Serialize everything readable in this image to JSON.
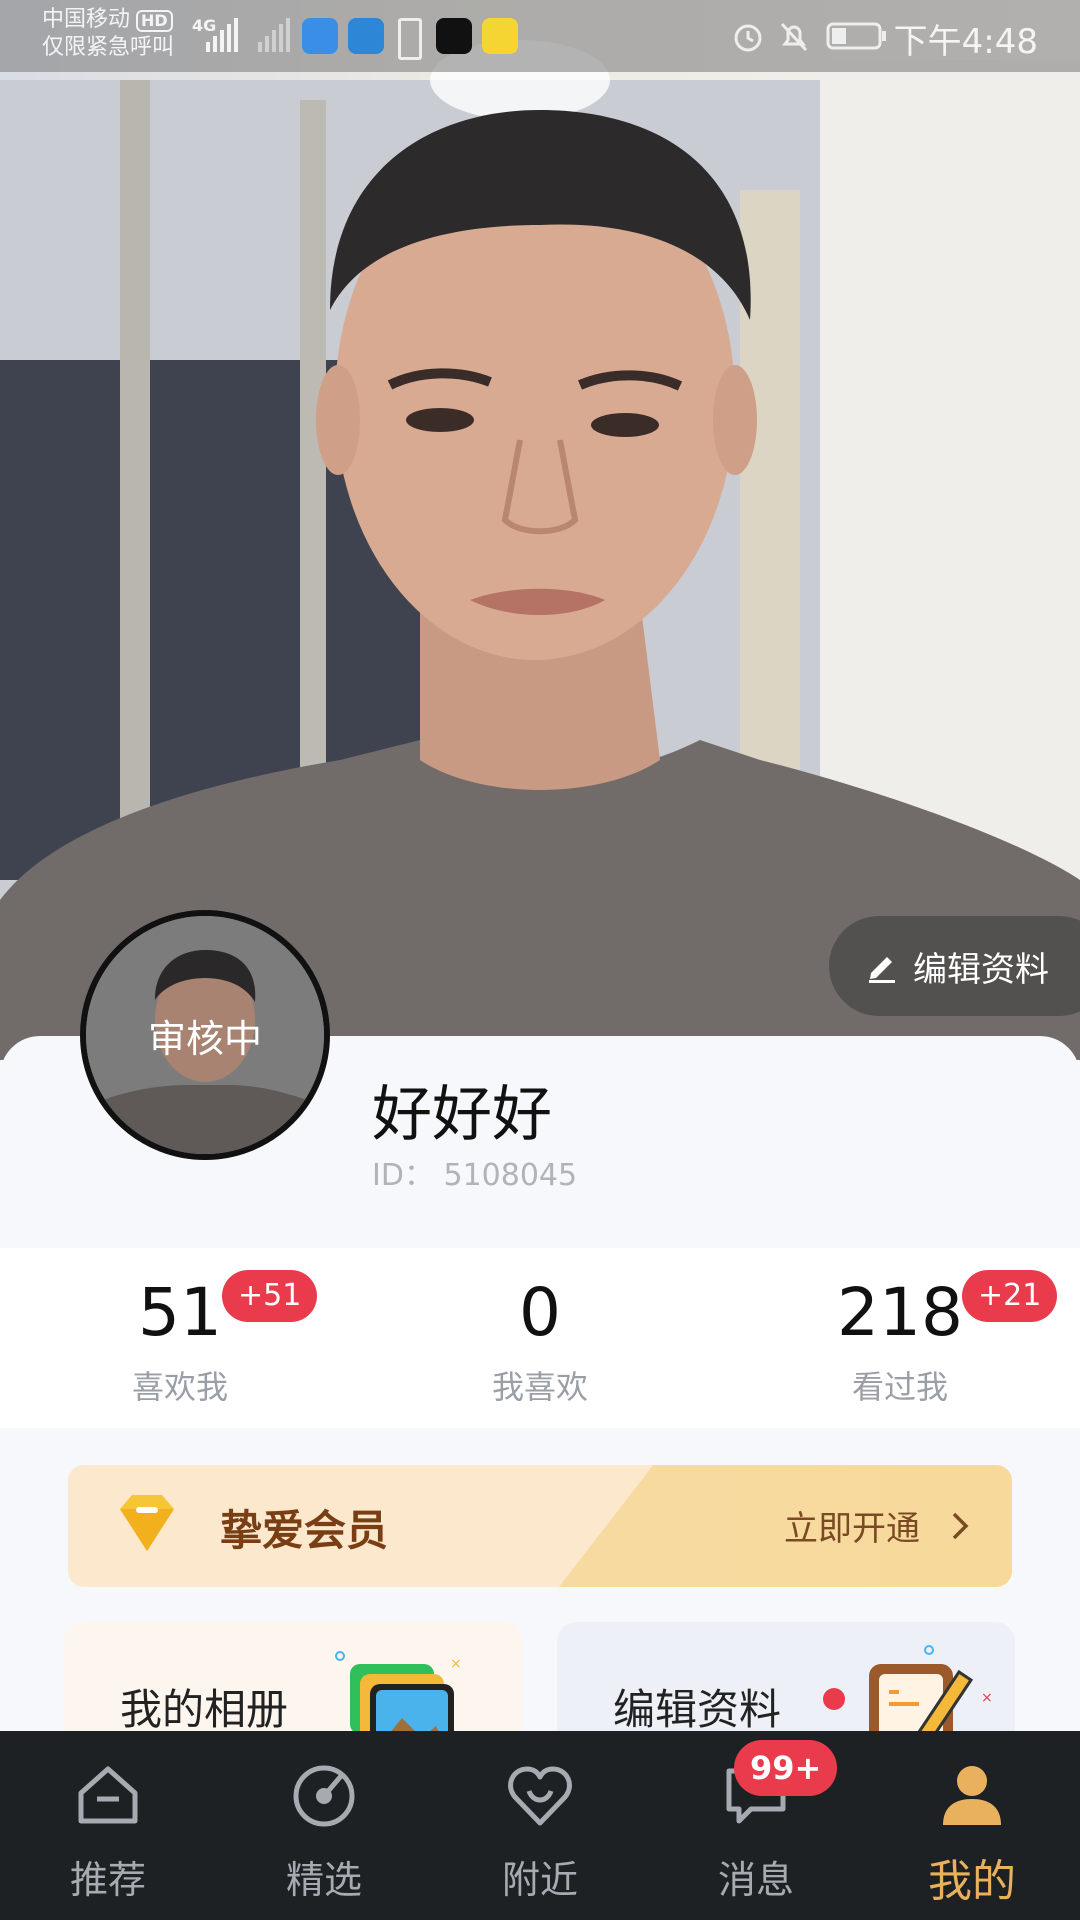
{
  "status_bar": {
    "carrier": "中国移动",
    "hd": "HD",
    "emergency": "仅限紧急呼叫",
    "network": "4G",
    "time": "下午4:48"
  },
  "profile": {
    "avatar_status": "审核中",
    "nickname": "好好好",
    "id_text": "ID： 5108045",
    "edit_button": "编辑资料"
  },
  "stats": [
    {
      "value": "51",
      "label": "喜欢我",
      "badge": "+51"
    },
    {
      "value": "0",
      "label": "我喜欢",
      "badge": ""
    },
    {
      "value": "218",
      "label": "看过我",
      "badge": "+21"
    }
  ],
  "vip": {
    "title": "挚爱会员",
    "cta": "立即开通"
  },
  "features": [
    {
      "label": "我的相册"
    },
    {
      "label": "编辑资料"
    }
  ],
  "bottom_nav": {
    "items": [
      {
        "label": "推荐",
        "icon": "home-icon"
      },
      {
        "label": "精选",
        "icon": "compass-icon"
      },
      {
        "label": "附近",
        "icon": "heart-icon"
      },
      {
        "label": "消息",
        "icon": "chat-icon"
      },
      {
        "label": "我的",
        "icon": "user-icon",
        "active": true
      }
    ],
    "message_badge": "99+"
  },
  "colors": {
    "accent_red": "#ea3b4d",
    "active_gold": "#e9b15d",
    "nav_bg": "#1e2124",
    "vip_brown": "#7a3e14"
  }
}
